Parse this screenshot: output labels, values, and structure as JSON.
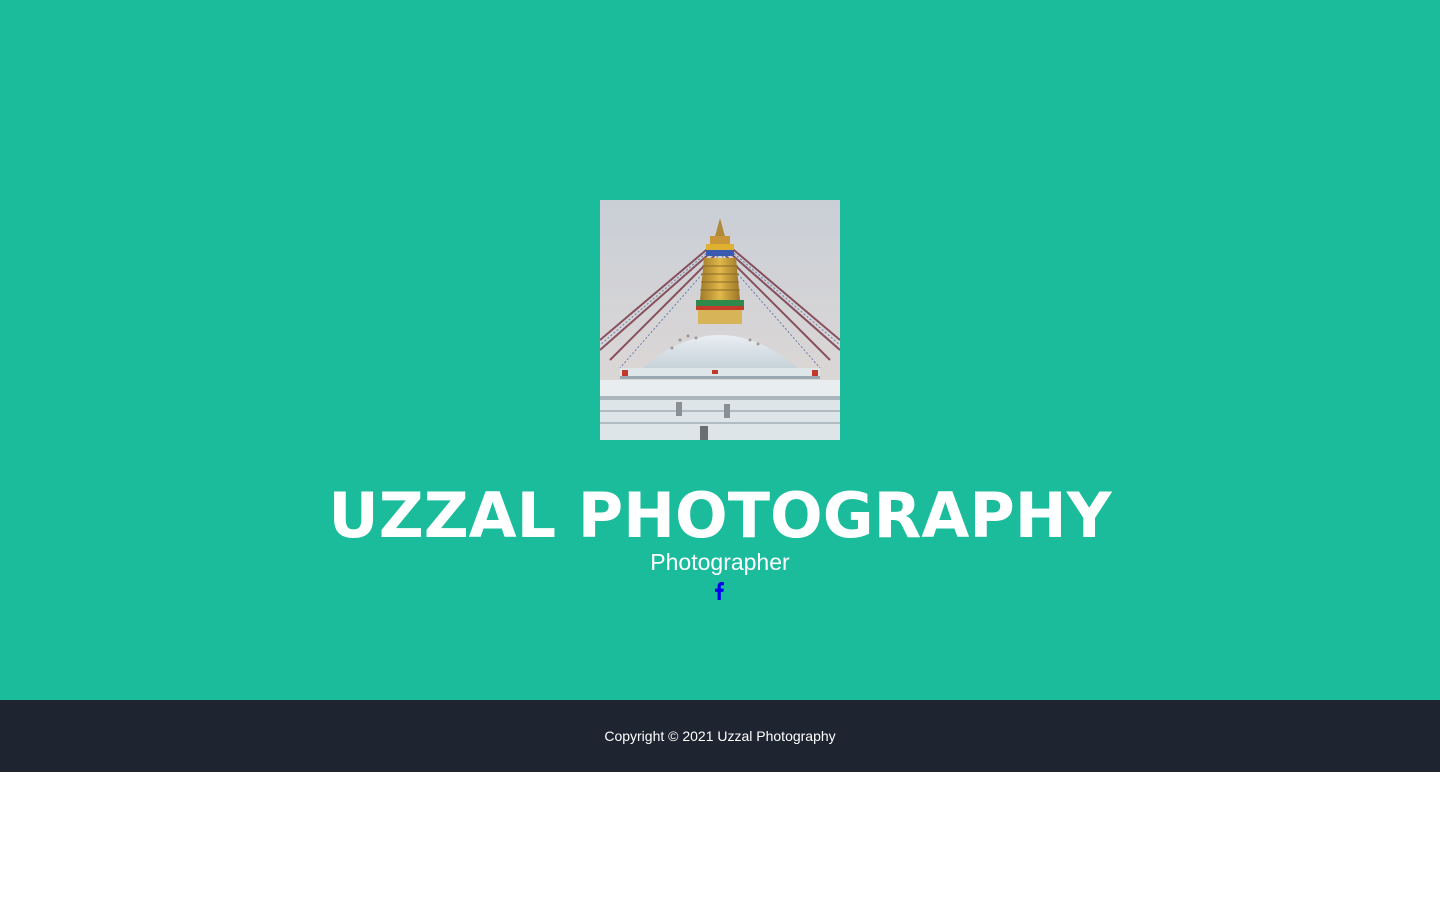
{
  "colors": {
    "masthead_bg": "#1abc9c",
    "footer_bg": "#1e2530",
    "text": "#ffffff",
    "social_icon": "#0000ee"
  },
  "header": {
    "title": "UZZAL PHOTOGRAPHY",
    "subtitle": "Photographer"
  },
  "profile": {
    "image_icon": "stupa-photo"
  },
  "social": {
    "links": [
      {
        "icon": "facebook-icon"
      }
    ]
  },
  "footer": {
    "copyright": "Copyright © 2021 Uzzal Photography"
  }
}
